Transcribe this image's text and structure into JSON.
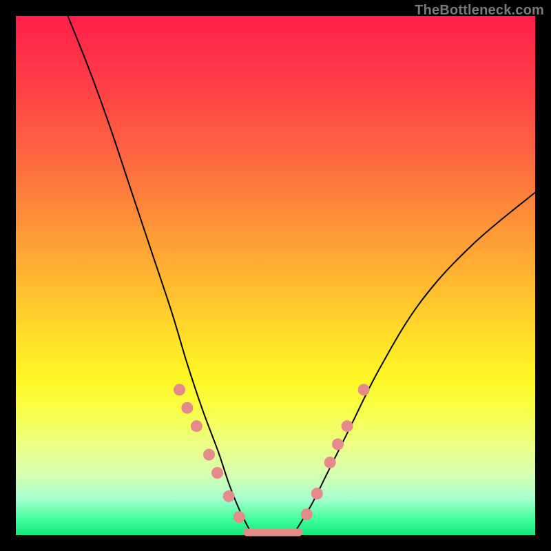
{
  "watermark": "TheBottleneck.com",
  "colors": {
    "curve_stroke": "#000000",
    "dot_fill": "#e58a8a",
    "bottom_line": "#e58a8a"
  },
  "chart_data": {
    "type": "line",
    "title": "",
    "xlabel": "",
    "ylabel": "",
    "xlim": [
      0,
      100
    ],
    "ylim": [
      0,
      100
    ],
    "series": [
      {
        "name": "left-branch",
        "x": [
          10,
          14,
          18,
          22,
          26,
          30,
          33,
          36,
          39,
          41,
          43,
          45
        ],
        "y": [
          100,
          90,
          79,
          67,
          55,
          43,
          33,
          24,
          16,
          10,
          5,
          1
        ]
      },
      {
        "name": "bottom-flat",
        "x": [
          45,
          48,
          51,
          54
        ],
        "y": [
          0,
          0,
          0,
          0
        ]
      },
      {
        "name": "right-branch",
        "x": [
          54,
          57,
          60,
          64,
          70,
          78,
          88,
          100
        ],
        "y": [
          1,
          6,
          12,
          20,
          32,
          45,
          56,
          66
        ]
      }
    ],
    "markers": {
      "name": "highlight-dots",
      "points": [
        {
          "x": 31.5,
          "y": 28
        },
        {
          "x": 33.0,
          "y": 24.5
        },
        {
          "x": 34.8,
          "y": 21
        },
        {
          "x": 37.2,
          "y": 15.5
        },
        {
          "x": 38.8,
          "y": 12
        },
        {
          "x": 41.0,
          "y": 7.5
        },
        {
          "x": 43.0,
          "y": 3.5
        },
        {
          "x": 56.0,
          "y": 4
        },
        {
          "x": 58.0,
          "y": 8
        },
        {
          "x": 60.5,
          "y": 14
        },
        {
          "x": 62.0,
          "y": 17.5
        },
        {
          "x": 63.8,
          "y": 21
        },
        {
          "x": 67.0,
          "y": 28
        }
      ]
    },
    "bottom_segment": {
      "x0": 44.5,
      "x1": 54.5,
      "y": 0
    }
  }
}
